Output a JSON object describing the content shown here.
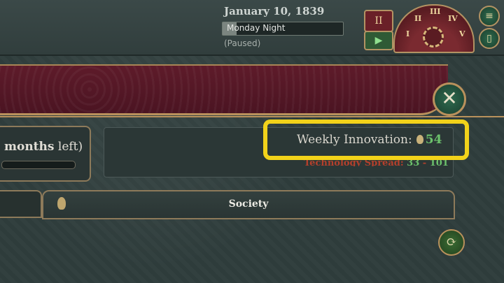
{
  "header": {
    "date": "January 10, 1839",
    "time_of_day": "Monday Night",
    "status": "(Paused)"
  },
  "speed": {
    "pause_symbol": "II",
    "play_symbol": "▶",
    "labels": [
      "I",
      "II",
      "III",
      "IV",
      "V"
    ]
  },
  "panel": {
    "months_word": "months",
    "left_word": " left)"
  },
  "innovation": {
    "label": "Weekly Innovation:",
    "value": "54"
  },
  "spread": {
    "label": "Technology Spread:",
    "value1": "33",
    "sep": " - ",
    "value2": "101"
  },
  "tabs": {
    "society": "Society"
  },
  "colors": {
    "highlight": "#f2d21a",
    "positive": "#6cc26c",
    "banner": "#5e1b2a"
  }
}
